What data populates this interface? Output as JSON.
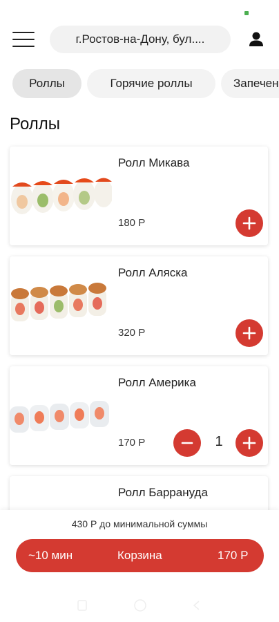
{
  "header": {
    "address": "г.Ростов-на-Дону, бул....",
    "menu_icon": "hamburger-menu-icon",
    "user_icon": "user-icon"
  },
  "categories": [
    {
      "label": "Роллы",
      "active": true
    },
    {
      "label": "Горячие роллы",
      "active": false
    },
    {
      "label": "Запеченные",
      "active": false
    }
  ],
  "section_title": "Роллы",
  "products": [
    {
      "name": "Ролл Микава",
      "price": "180 Р",
      "quantity": 0
    },
    {
      "name": "Ролл Аляска",
      "price": "320 Р",
      "quantity": 0
    },
    {
      "name": "Ролл Америка",
      "price": "170 Р",
      "quantity": 1,
      "quantity_text": "1"
    },
    {
      "name": "Ролл Баррануда",
      "price": "",
      "quantity": 0
    }
  ],
  "cart": {
    "min_note": "430 Р до минимальной суммы",
    "time": "~10 мин",
    "label": "Корзина",
    "total": "170 Р"
  },
  "colors": {
    "accent": "#d43a31",
    "chip_bg": "#f3f3f3"
  }
}
